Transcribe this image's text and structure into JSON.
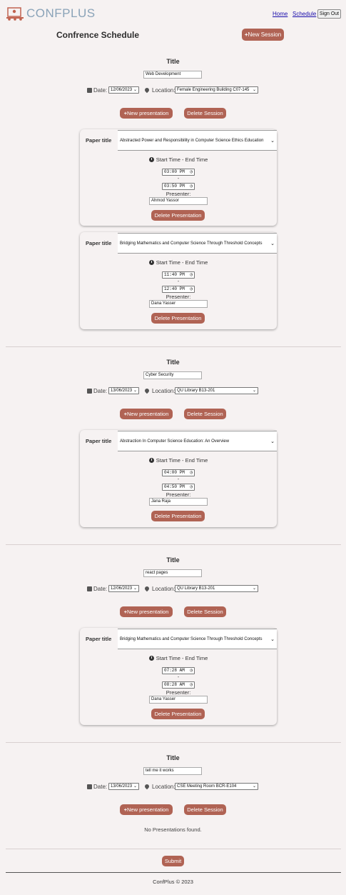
{
  "header": {
    "logo_text": "CONFPLUS",
    "nav": {
      "home": "Home",
      "schedule": "Schedule",
      "sign_out": "Sign Out"
    }
  },
  "page": {
    "title": "Confrence Schedule",
    "new_session_label": "New Session"
  },
  "labels": {
    "title": "Title",
    "date": "Date:",
    "location": "Location:",
    "new_presentation": "New presentation",
    "delete_session": "Delete Session",
    "paper_title": "Paper title",
    "start_end": "Start Time - End Time",
    "dash": "-",
    "presenter": "Presenter:",
    "delete_presentation": "Delete Presentation",
    "submit": "Submit"
  },
  "sessions": [
    {
      "title": "Web Development",
      "date": "12/06/2023",
      "location": "Female Engineering Building C07-145",
      "presentations": [
        {
          "paper": "Abstracted Power and Responsibility in Computer Science Ethics Education",
          "start": "03:00 PM",
          "end": "03:50 PM",
          "presenter": "Ahmod  Yassor"
        },
        {
          "paper": "Bridging Mathematics and Computer Science Through Threshold Concepts",
          "start": "11:40 PM",
          "end": "12:40 PM",
          "presenter": "Dana  Yasser"
        }
      ]
    },
    {
      "title": "Cyber Security",
      "date": "13/06/2023",
      "location": "QU Library B13-201",
      "presentations": [
        {
          "paper": "Abstraction In Computer Science Education: An Overview",
          "start": "04:00 PM",
          "end": "04:50 PM",
          "presenter": "Jana  Raja"
        }
      ]
    },
    {
      "title": "react pages",
      "date": "12/06/2023",
      "location": "QU Library B13-201",
      "presentations": [
        {
          "paper": "Bridging Mathematics and Computer Science Through Threshold Concepts",
          "start": "07:28 AM",
          "end": "08:28 AM",
          "presenter": "Dana  Yasser"
        }
      ]
    },
    {
      "title": "tell me it works",
      "date": "13/06/2023",
      "location": "CSE Meeting Room BCR-E104",
      "presentations": [],
      "empty_text": "No Presentations found."
    }
  ],
  "footer": {
    "text": "ConfPlus © 2023"
  },
  "colors": {
    "accent": "#b06354",
    "background": "#f6f2f2",
    "logo": "#8aa3b8",
    "link": "#1a0dab"
  }
}
